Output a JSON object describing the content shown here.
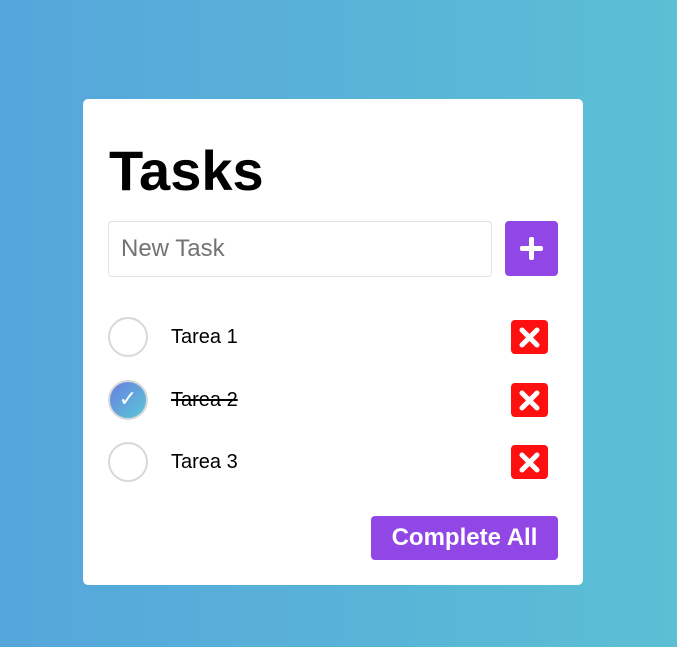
{
  "app": {
    "title": "Tasks"
  },
  "new_task": {
    "placeholder": "New Task",
    "value": "",
    "add_icon": "plus-icon"
  },
  "tasks": [
    {
      "label": "Tarea 1",
      "completed": false,
      "delete_icon": "close-icon"
    },
    {
      "label": "Tarea 2",
      "completed": true,
      "check_mark": "✓",
      "delete_icon": "close-icon"
    },
    {
      "label": "Tarea 3",
      "completed": false,
      "delete_icon": "close-icon"
    }
  ],
  "actions": {
    "complete_all_label": "Complete All"
  },
  "colors": {
    "accent": "#9146e6",
    "delete": "#ff1010",
    "background_start": "#55a6db",
    "background_end": "#5cbfd4"
  }
}
